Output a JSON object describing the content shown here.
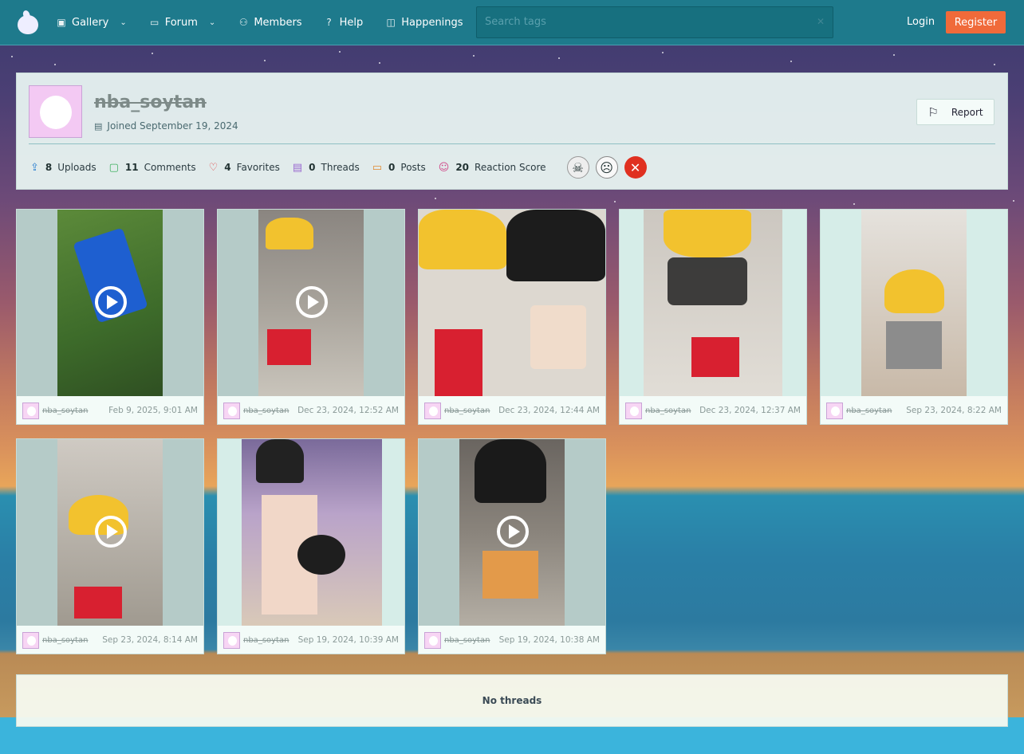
{
  "nav": {
    "items": [
      {
        "label": "Gallery",
        "icon": "gallery-icon",
        "dropdown": true
      },
      {
        "label": "Forum",
        "icon": "forum-icon",
        "dropdown": true
      },
      {
        "label": "Members",
        "icon": "members-icon",
        "dropdown": false
      },
      {
        "label": "Help",
        "icon": "help-icon",
        "dropdown": false
      },
      {
        "label": "Happenings",
        "icon": "book-icon",
        "dropdown": false
      }
    ],
    "search_placeholder": "Search tags",
    "login_label": "Login",
    "register_label": "Register"
  },
  "profile": {
    "username": "nba_soytan",
    "joined": "Joined September 19, 2024",
    "report_label": "Report",
    "stats": [
      {
        "count": "8",
        "label": "Uploads",
        "icon": "upload-icon",
        "color": "#2a7fd0"
      },
      {
        "count": "11",
        "label": "Comments",
        "icon": "comment-icon",
        "color": "#3fb060"
      },
      {
        "count": "4",
        "label": "Favorites",
        "icon": "heart-icon",
        "color": "#e04848"
      },
      {
        "count": "0",
        "label": "Threads",
        "icon": "document-icon",
        "color": "#9a6ad0"
      },
      {
        "count": "0",
        "label": "Posts",
        "icon": "posts-icon",
        "color": "#e08a30"
      },
      {
        "count": "20",
        "label": "Reaction Score",
        "icon": "reaction-icon",
        "color": "#d04a8a"
      }
    ],
    "badges": [
      "skull-star-badge",
      "soyjak-badge",
      "red-face-badge"
    ]
  },
  "uploads": [
    {
      "user": "nba_soytan",
      "date": "Feb 9, 2025, 9:01 AM",
      "video": true
    },
    {
      "user": "nba_soytan",
      "date": "Dec 23, 2024, 12:52 AM",
      "video": true
    },
    {
      "user": "nba_soytan",
      "date": "Dec 23, 2024, 12:44 AM",
      "video": false
    },
    {
      "user": "nba_soytan",
      "date": "Dec 23, 2024, 12:37 AM",
      "video": false
    },
    {
      "user": "nba_soytan",
      "date": "Sep 23, 2024, 8:22 AM",
      "video": false
    },
    {
      "user": "nba_soytan",
      "date": "Sep 23, 2024, 8:14 AM",
      "video": true
    },
    {
      "user": "nba_soytan",
      "date": "Sep 19, 2024, 10:39 AM",
      "video": false
    },
    {
      "user": "nba_soytan",
      "date": "Sep 19, 2024, 10:38 AM",
      "video": true
    }
  ],
  "threads": {
    "empty_label": "No threads"
  }
}
